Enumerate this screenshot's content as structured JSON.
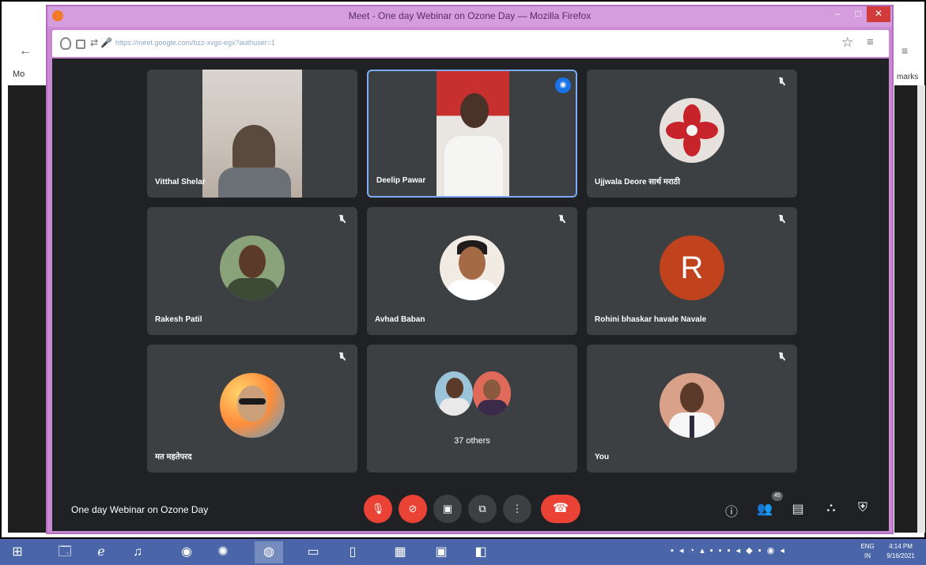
{
  "window": {
    "title": "Meet - One day Webinar on Ozone Day — Mozilla Firefox",
    "minimize": "–",
    "maximize": "□",
    "close": "✕"
  },
  "browser": {
    "url": "https://meet.google.com/bzz-xvgs-egx?authuser=1",
    "background_tab_label": "Mo",
    "background_bookmarks_label": "marks"
  },
  "meeting": {
    "title": "One day Webinar on Ozone Day",
    "people_count": "45",
    "tiles": [
      {
        "name": "Vitthal Shelar",
        "kind": "video",
        "muted": false
      },
      {
        "name": "Deelip Pawar",
        "kind": "video",
        "speaking": true
      },
      {
        "name": "Ujjwala Deore सार्थ मराठी",
        "kind": "avatar-photo",
        "muted": true
      },
      {
        "name": "Rakesh Patil",
        "kind": "avatar-photo",
        "muted": true
      },
      {
        "name": "Avhad Baban",
        "kind": "avatar-photo",
        "muted": true
      },
      {
        "name": "Rohini bhaskar havale Navale",
        "kind": "avatar-letter",
        "letter": "R",
        "muted": true
      },
      {
        "name": "मत महतेपरद",
        "kind": "avatar-photo",
        "muted": true
      },
      {
        "name": "",
        "kind": "others",
        "others_label": "37 others"
      },
      {
        "name": "You",
        "kind": "avatar-photo",
        "muted": true
      }
    ],
    "controls": [
      {
        "name": "mic-off-button",
        "icon": "mic-off-icon"
      },
      {
        "name": "camera-off-button",
        "icon": "camera-off-icon"
      },
      {
        "name": "captions-button",
        "icon": "captions-icon"
      },
      {
        "name": "present-button",
        "icon": "present-icon"
      },
      {
        "name": "more-options-button",
        "icon": "more-vert-icon"
      },
      {
        "name": "end-call-button",
        "icon": "phone-hangup-icon"
      }
    ],
    "right_controls": [
      {
        "name": "meeting-details-button",
        "icon": "info-icon"
      },
      {
        "name": "people-button",
        "icon": "people-icon"
      },
      {
        "name": "chat-button",
        "icon": "chat-icon"
      },
      {
        "name": "activities-button",
        "icon": "activities-icon"
      },
      {
        "name": "host-controls-button",
        "icon": "shield-icon"
      }
    ]
  },
  "taskbar": {
    "apps": [
      "start-button",
      "explorer",
      "internet-explorer",
      "media-player",
      "chrome",
      "firefox-old",
      "firefox",
      "zoom",
      "notepad",
      "file-explorer",
      "powerpoint",
      "office"
    ],
    "language_top": "ENG",
    "language_bottom": "IN",
    "time": "4:14 PM",
    "date": "9/16/2021"
  },
  "colors": {
    "meet_bg": "#202124",
    "tile_bg": "#3c4043",
    "red": "#ea4335",
    "avatar_R": "#c1431e",
    "window_frame": "#c98ad3",
    "taskbar": "#4a66a8"
  }
}
